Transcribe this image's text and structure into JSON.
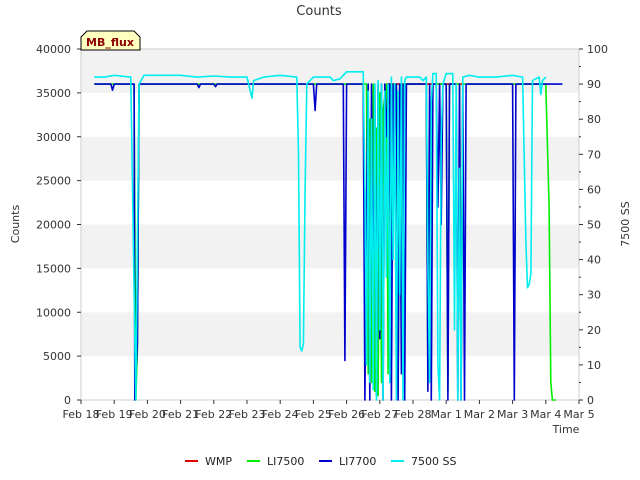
{
  "chart_data": {
    "type": "line",
    "title": "Counts",
    "xlabel": "Time",
    "ylabel": "Counts",
    "y2label": "7500 SS",
    "badge": "MB_flux",
    "x_ticks": [
      "Feb 18",
      "Feb 19",
      "Feb 20",
      "Feb 21",
      "Feb 22",
      "Feb 23",
      "Feb 24",
      "Feb 25",
      "Feb 26",
      "Feb 27",
      "Feb 28",
      "Mar 1",
      "Mar 2",
      "Mar 3",
      "Mar 4",
      "Mar 5"
    ],
    "xlim": [
      0,
      15
    ],
    "ylim": [
      0,
      40000
    ],
    "y_ticks": [
      0,
      5000,
      10000,
      15000,
      20000,
      25000,
      30000,
      35000,
      40000
    ],
    "y2lim": [
      0,
      100
    ],
    "y2_ticks": [
      0,
      10,
      20,
      30,
      40,
      50,
      60,
      70,
      80,
      90,
      100
    ],
    "x_unit": "days since Feb 18",
    "legend_position": "bottom-center",
    "series": [
      {
        "name": "WMP",
        "color": "#dd0000",
        "axis": "left",
        "points": [
          [
            9.2,
            36000
          ],
          [
            9.7,
            36000
          ],
          [
            10.5,
            36000
          ],
          [
            10.7,
            36000
          ],
          [
            11.3,
            36000
          ],
          [
            11.5,
            36000
          ]
        ]
      },
      {
        "name": "LI7500",
        "color": "#00ee00",
        "axis": "left",
        "points": [
          [
            0.4,
            36000
          ],
          [
            1.6,
            36000
          ],
          [
            1.65,
            0
          ],
          [
            1.7,
            6000
          ],
          [
            1.75,
            36000
          ],
          [
            8.4,
            36000
          ],
          [
            8.6,
            36000
          ],
          [
            8.65,
            3000
          ],
          [
            8.7,
            32000
          ],
          [
            8.75,
            2000
          ],
          [
            8.8,
            36000
          ],
          [
            8.85,
            1000
          ],
          [
            8.9,
            31000
          ],
          [
            8.95,
            500
          ],
          [
            9.0,
            35000
          ],
          [
            9.05,
            2000
          ],
          [
            9.1,
            33000
          ],
          [
            9.2,
            36000
          ],
          [
            9.25,
            3000
          ],
          [
            9.3,
            36000
          ],
          [
            9.35,
            20000
          ],
          [
            9.4,
            36000
          ],
          [
            9.5,
            36000
          ],
          [
            9.55,
            1000
          ],
          [
            9.6,
            36000
          ],
          [
            9.65,
            8000
          ],
          [
            9.7,
            36000
          ],
          [
            9.8,
            36000
          ],
          [
            9.9,
            36000
          ],
          [
            10.4,
            36000
          ],
          [
            10.45,
            3000
          ],
          [
            10.5,
            31000
          ],
          [
            10.55,
            20000
          ],
          [
            10.6,
            36000
          ],
          [
            11.0,
            36000
          ],
          [
            11.05,
            1000
          ],
          [
            11.1,
            36000
          ],
          [
            11.3,
            36000
          ],
          [
            11.4,
            36000
          ],
          [
            11.45,
            5000
          ],
          [
            11.5,
            36000
          ],
          [
            13.9,
            36000
          ],
          [
            14.0,
            36000
          ],
          [
            14.1,
            22000
          ],
          [
            14.15,
            2000
          ],
          [
            14.2,
            0
          ],
          [
            14.3,
            0
          ]
        ]
      },
      {
        "name": "LI7700",
        "color": "#0000cc",
        "axis": "left",
        "points": [
          [
            0.4,
            36000
          ],
          [
            0.9,
            36000
          ],
          [
            0.95,
            35300
          ],
          [
            1.0,
            36000
          ],
          [
            1.6,
            36000
          ],
          [
            1.62,
            0
          ],
          [
            1.7,
            6500
          ],
          [
            1.75,
            36000
          ],
          [
            3.5,
            36000
          ],
          [
            3.55,
            35600
          ],
          [
            3.6,
            36000
          ],
          [
            4.0,
            36000
          ],
          [
            4.05,
            35700
          ],
          [
            4.1,
            36000
          ],
          [
            7.0,
            36000
          ],
          [
            7.05,
            33000
          ],
          [
            7.1,
            36000
          ],
          [
            7.9,
            36000
          ],
          [
            7.95,
            4500
          ],
          [
            8.0,
            36000
          ],
          [
            8.5,
            36000
          ],
          [
            8.55,
            0
          ],
          [
            8.6,
            22000
          ],
          [
            8.65,
            36000
          ],
          [
            8.7,
            0
          ],
          [
            8.75,
            36000
          ],
          [
            8.8,
            9000
          ],
          [
            8.85,
            36000
          ],
          [
            8.9,
            500
          ],
          [
            8.95,
            36000
          ],
          [
            9.0,
            7000
          ],
          [
            9.05,
            36000
          ],
          [
            9.1,
            0
          ],
          [
            9.15,
            36000
          ],
          [
            9.2,
            30000
          ],
          [
            9.25,
            36000
          ],
          [
            9.3,
            36000
          ],
          [
            9.35,
            0
          ],
          [
            9.4,
            36000
          ],
          [
            9.45,
            30000
          ],
          [
            9.5,
            36000
          ],
          [
            9.55,
            0
          ],
          [
            9.6,
            36000
          ],
          [
            9.65,
            3000
          ],
          [
            9.7,
            36000
          ],
          [
            9.75,
            0
          ],
          [
            9.8,
            36000
          ],
          [
            10.4,
            36000
          ],
          [
            10.45,
            1000
          ],
          [
            10.5,
            36000
          ],
          [
            10.55,
            0
          ],
          [
            10.6,
            36000
          ],
          [
            10.7,
            36000
          ],
          [
            10.75,
            22000
          ],
          [
            10.8,
            36000
          ],
          [
            10.85,
            20000
          ],
          [
            10.9,
            36000
          ],
          [
            11.0,
            36000
          ],
          [
            11.05,
            0
          ],
          [
            11.1,
            36000
          ],
          [
            11.3,
            36000
          ],
          [
            11.35,
            0
          ],
          [
            11.4,
            36000
          ],
          [
            11.45,
            0
          ],
          [
            11.5,
            36000
          ],
          [
            11.55,
            0
          ],
          [
            11.6,
            36000
          ],
          [
            13.0,
            36000
          ],
          [
            13.05,
            0
          ],
          [
            13.1,
            36000
          ],
          [
            14.5,
            36000
          ]
        ]
      },
      {
        "name": "7500 SS",
        "color": "#00eeee",
        "axis": "right",
        "points": [
          [
            0.4,
            92
          ],
          [
            0.7,
            92
          ],
          [
            1.0,
            92.5
          ],
          [
            1.5,
            92
          ],
          [
            1.65,
            0
          ],
          [
            1.75,
            90
          ],
          [
            1.9,
            92.5
          ],
          [
            2.5,
            92.5
          ],
          [
            3.0,
            92.5
          ],
          [
            3.5,
            92
          ],
          [
            4.0,
            92.3
          ],
          [
            4.5,
            92
          ],
          [
            5.0,
            92
          ],
          [
            5.1,
            88
          ],
          [
            5.15,
            86
          ],
          [
            5.2,
            91
          ],
          [
            5.5,
            92
          ],
          [
            6.0,
            92.5
          ],
          [
            6.5,
            92
          ],
          [
            6.55,
            70
          ],
          [
            6.6,
            15
          ],
          [
            6.65,
            14
          ],
          [
            6.7,
            16
          ],
          [
            6.75,
            60
          ],
          [
            6.8,
            90
          ],
          [
            7.0,
            92
          ],
          [
            7.5,
            92
          ],
          [
            7.6,
            91
          ],
          [
            7.8,
            91.5
          ],
          [
            8.0,
            93.5
          ],
          [
            8.3,
            93.5
          ],
          [
            8.5,
            93.5
          ],
          [
            8.55,
            60
          ],
          [
            8.6,
            10
          ],
          [
            8.65,
            88
          ],
          [
            8.7,
            5
          ],
          [
            8.75,
            80
          ],
          [
            8.8,
            3
          ],
          [
            8.85,
            90
          ],
          [
            8.9,
            0
          ],
          [
            8.95,
            91
          ],
          [
            9.0,
            20
          ],
          [
            9.05,
            90
          ],
          [
            9.1,
            0
          ],
          [
            9.15,
            88
          ],
          [
            9.2,
            35
          ],
          [
            9.25,
            90
          ],
          [
            9.3,
            5
          ],
          [
            9.35,
            92
          ],
          [
            9.4,
            40
          ],
          [
            9.45,
            90
          ],
          [
            9.5,
            0
          ],
          [
            9.55,
            88
          ],
          [
            9.6,
            30
          ],
          [
            9.65,
            92
          ],
          [
            9.7,
            0
          ],
          [
            9.75,
            91
          ],
          [
            9.8,
            92
          ],
          [
            10.2,
            92
          ],
          [
            10.3,
            91
          ],
          [
            10.4,
            92
          ],
          [
            10.45,
            40
          ],
          [
            10.5,
            5
          ],
          [
            10.55,
            85
          ],
          [
            10.6,
            93
          ],
          [
            10.7,
            93
          ],
          [
            10.75,
            10
          ],
          [
            10.8,
            0
          ],
          [
            10.85,
            75
          ],
          [
            10.9,
            90
          ],
          [
            11.0,
            93
          ],
          [
            11.2,
            93
          ],
          [
            11.25,
            20
          ],
          [
            11.3,
            90
          ],
          [
            11.35,
            0
          ],
          [
            11.4,
            66
          ],
          [
            11.45,
            0
          ],
          [
            11.5,
            92
          ],
          [
            11.7,
            92.5
          ],
          [
            12.0,
            92
          ],
          [
            12.5,
            92
          ],
          [
            13.0,
            92.5
          ],
          [
            13.3,
            92
          ],
          [
            13.4,
            45
          ],
          [
            13.45,
            32
          ],
          [
            13.5,
            33
          ],
          [
            13.55,
            36
          ],
          [
            13.6,
            91
          ],
          [
            13.8,
            92
          ],
          [
            13.85,
            87
          ],
          [
            13.9,
            91
          ],
          [
            14.0,
            92
          ]
        ]
      }
    ]
  }
}
